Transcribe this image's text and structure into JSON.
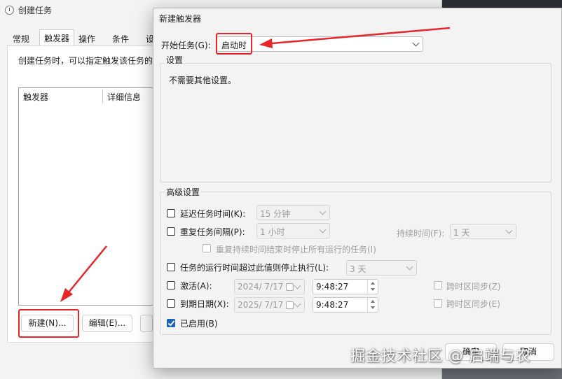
{
  "background_window": {
    "title": "创建任务",
    "tabs": [
      "常规",
      "触发器",
      "操作",
      "条件",
      "设"
    ],
    "description": "创建任务时，可以指定触发该任务的",
    "columns": [
      "触发器",
      "详细信息"
    ],
    "new_button": "新建(N)...",
    "edit_button": "编辑(E)..."
  },
  "dialog": {
    "title": "新建触发器",
    "start_task_label": "开始任务(G):",
    "start_task_value": "启动时",
    "settings_group": "设置",
    "settings_text": "不需要其他设置。",
    "advanced_group": "高级设置",
    "delay": {
      "label": "延迟任务时间(K):",
      "value": "15 分钟",
      "checked": false
    },
    "repeat": {
      "label": "重复任务间隔(P):",
      "value": "1 小时",
      "checked": false
    },
    "duration": {
      "label": "持续时间(F):",
      "value": "1 天"
    },
    "stop_all": {
      "label": "重复持续时间结束时停止所有运行的任务(I)",
      "checked": false
    },
    "stop_longer": {
      "label": "任务的运行时间超过此值则停止执行(L):",
      "value": "3 天",
      "checked": false
    },
    "activate": {
      "label": "激活(A):",
      "date": "2024/  7/17",
      "time": "9:48:27",
      "sync": "跨时区同步(Z)",
      "checked": false
    },
    "expire": {
      "label": "到期日期(X):",
      "date": "2025/  7/17",
      "time": "9:48:27",
      "sync": "跨时区同步(E)",
      "checked": false
    },
    "enabled": {
      "label": "已启用(B)",
      "checked": true
    },
    "ok_button": "确定",
    "cancel_button": "取消"
  },
  "watermark": "掘金技术社区 @ 启端与农",
  "colors": {
    "accent": "#1a62b8",
    "highlight": "#e8262a"
  }
}
